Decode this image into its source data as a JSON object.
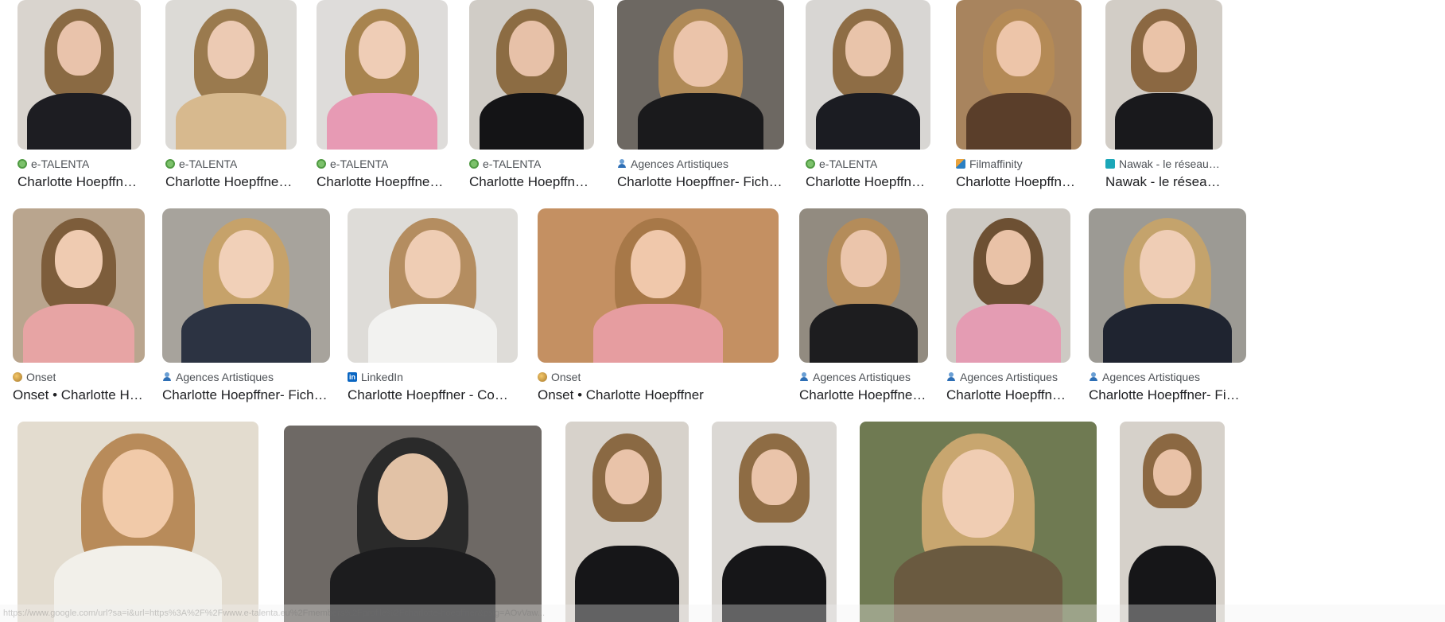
{
  "results": [
    {
      "source": "e-TALENTA",
      "favicon": "fav-talenta",
      "title": "Charlotte Hoepffner - e-TALENTA",
      "photo": {
        "bg": "#d9d4ce",
        "hair": "#8a6a43",
        "skin": "#e9c3ab",
        "cloth": "#1d1d22"
      }
    },
    {
      "source": "e-TALENTA",
      "favicon": "fav-talenta",
      "title": "Charlotte Hoepffner - e-TALENTA",
      "photo": {
        "bg": "#dcdad6",
        "hair": "#9a7a4e",
        "skin": "#eccab3",
        "cloth": "#d7b98e"
      }
    },
    {
      "source": "e-TALENTA",
      "favicon": "fav-talenta",
      "title": "Charlotte Hoepffner - e-TALENTA",
      "photo": {
        "bg": "#dedcda",
        "hair": "#a8844f",
        "skin": "#efcdb6",
        "cloth": "#e79ab4"
      }
    },
    {
      "source": "e-TALENTA",
      "favicon": "fav-talenta",
      "title": "Charlotte Hoepffner - e-TALENTA",
      "photo": {
        "bg": "#d0ccc6",
        "hair": "#8c6c43",
        "skin": "#e7c1a8",
        "cloth": "#141416"
      }
    },
    {
      "source": "Agences Artistiques",
      "favicon": "fav-agences",
      "title": "Charlotte Hoepffner- Fiche Artiste",
      "photo": {
        "bg": "#6d6862",
        "hair": "#b08a57",
        "skin": "#ebc4aa",
        "cloth": "#1a1a1c"
      }
    },
    {
      "source": "e-TALENTA",
      "favicon": "fav-talenta",
      "title": "Charlotte Hoepffner - e-TALENTA",
      "photo": {
        "bg": "#d8d6d3",
        "hair": "#8e6d45",
        "skin": "#e9c4aa",
        "cloth": "#1b1c22"
      }
    },
    {
      "source": "Filmaffinity",
      "favicon": "fav-film",
      "title": "Charlotte Hoepffner - Filmaffinity",
      "photo": {
        "bg": "#a8845e",
        "hair": "#b48a56",
        "skin": "#edc5a9",
        "cloth": "#5a3e2a"
      }
    },
    {
      "source": "Nawak - le réseau du s...",
      "favicon": "fav-nawak",
      "title": "Nawak - le réseau du spectacle",
      "photo": {
        "bg": "#d2cdc6",
        "hair": "#8b6842",
        "skin": "#eac3a8",
        "cloth": "#19191c"
      }
    },
    {
      "source": "Onset",
      "favicon": "fav-onset",
      "title": "Onset • Charlotte Hoepffner",
      "photo": {
        "bg": "#b9a58e",
        "hair": "#7d5d3b",
        "skin": "#efcbb1",
        "cloth": "#e7a4a4"
      }
    },
    {
      "source": "Agences Artistiques",
      "favicon": "fav-agences",
      "title": "Charlotte Hoepffner- Fiche Artiste",
      "photo": {
        "bg": "#a7a39c",
        "hair": "#c6a26a",
        "skin": "#f1d0b8",
        "cloth": "#2c3342"
      }
    },
    {
      "source": "LinkedIn",
      "favicon": "fav-linkedin",
      "title": "Charlotte Hoepffner - Comedienne - LinkedIn",
      "photo": {
        "bg": "#dedcd8",
        "hair": "#b48d60",
        "skin": "#efcdb4",
        "cloth": "#f2f2f0"
      }
    },
    {
      "source": "Onset",
      "favicon": "fav-onset",
      "title": "Onset • Charlotte Hoepffner",
      "photo": {
        "bg": "#c49062",
        "hair": "#a77848",
        "skin": "#f0c8ab",
        "cloth": "#e69da0"
      }
    },
    {
      "source": "Agences Artistiques",
      "favicon": "fav-agences",
      "title": "Charlotte Hoepffner- Fiche Artiste",
      "photo": {
        "bg": "#928b80",
        "hair": "#b48c5a",
        "skin": "#ebc5ab",
        "cloth": "#1d1d1f"
      }
    },
    {
      "source": "Agences Artistiques",
      "favicon": "fav-agences",
      "title": "Charlotte Hoepffner- Fiche Artiste",
      "photo": {
        "bg": "#cdc9c3",
        "hair": "#6d5033",
        "skin": "#e9c2a7",
        "cloth": "#e49cb3"
      }
    },
    {
      "source": "Agences Artistiques",
      "favicon": "fav-agences",
      "title": "Charlotte Hoepffner- Fiche Artiste",
      "photo": {
        "bg": "#9c9a94",
        "hair": "#c4a36c",
        "skin": "#efcdb5",
        "cloth": "#1f2430"
      }
    },
    {
      "photo": {
        "bg": "#e3dccf",
        "hair": "#b88b5a",
        "skin": "#f1caa9",
        "cloth": "#f2f0ea"
      }
    },
    {
      "photo": {
        "bg": "#6e6965",
        "hair": "#2a2a2a",
        "skin": "#e2c2a6",
        "cloth": "#1c1c1e"
      }
    },
    {
      "photo": {
        "bg": "#d7d2cb",
        "hair": "#8a6943",
        "skin": "#e9c3a9",
        "cloth": "#161618"
      }
    },
    {
      "photo": {
        "bg": "#dbd8d4",
        "hair": "#8e6c44",
        "skin": "#eac4aa",
        "cloth": "#161618"
      }
    },
    {
      "photo": {
        "bg": "#6f7a52",
        "hair": "#c8a66f",
        "skin": "#f0cdb3",
        "cloth": "#6a5a40"
      }
    },
    {
      "photo": {
        "bg": "#d6d1ca",
        "hair": "#8b6842",
        "skin": "#e9c2a7",
        "cloth": "#161618"
      }
    }
  ],
  "status_url": "https://www.google.com/url?sa=i&url=https%3A%2F%2Fwww.e-talenta.eu%2Fmembers%2Fprofile%2Fcharlotte-hoepffner&psig=AOvVaw..."
}
